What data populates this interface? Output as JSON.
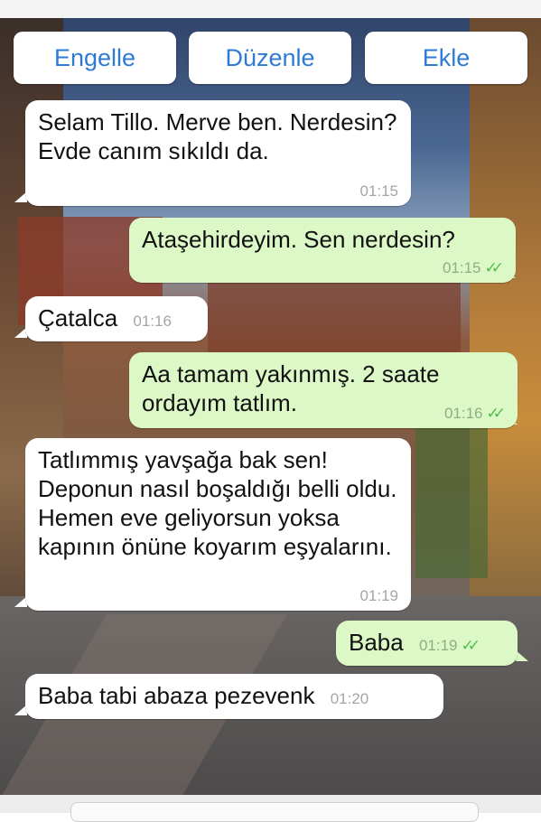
{
  "actions": {
    "block_label": "Engelle",
    "edit_label": "Düzenle",
    "add_label": "Ekle"
  },
  "messages": [
    {
      "direction": "in",
      "text": "Selam Tillo. Merve ben. Nerdesin? Evde canım sıkıldı da.",
      "time": "01:15"
    },
    {
      "direction": "out",
      "text": "Ataşehirdeyim. Sen nerdesin?",
      "time": "01:15",
      "status": "read"
    },
    {
      "direction": "in",
      "text": "Çatalca",
      "time": "01:16"
    },
    {
      "direction": "out",
      "text": "Aa tamam yakınmış. 2 saate ordayım tatlım.",
      "time": "01:16",
      "status": "read"
    },
    {
      "direction": "in",
      "text": "Tatlımmış yavşağa bak sen! Deponun nasıl boşaldığı belli oldu. Hemen eve geliyorsun yoksa kapının önüne koyarım eşyalarını.",
      "time": "01:19"
    },
    {
      "direction": "out",
      "text": "Baba",
      "time": "01:19",
      "status": "read"
    },
    {
      "direction": "in",
      "text": "Baba tabi abaza pezevenk",
      "time": "01:20"
    }
  ],
  "colors": {
    "incoming_bubble": "#ffffff",
    "outgoing_bubble": "#dcf8c6",
    "action_text": "#2e7bd6",
    "read_ticks": "#4fc04a"
  },
  "icons": {
    "read_receipt": "double-check-icon"
  }
}
